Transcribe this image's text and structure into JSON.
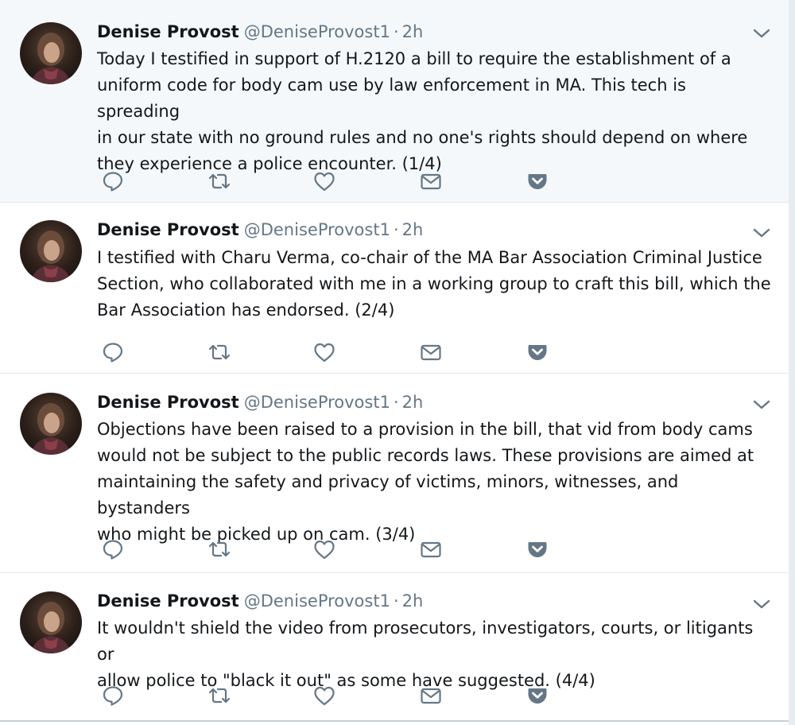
{
  "tweets": [
    {
      "author": "Denise Provost",
      "handle": "@DeniseProvost1",
      "separator": "·",
      "time": "2h",
      "text": "Today I testified in support of H.2120 a bill to require the establishment of a\nuniform code for body cam use by law enforcement in MA. This tech is spreading\nin our state with no ground rules and no one's rights should depend on where\nthey experience a police encounter. (1/4)"
    },
    {
      "author": "Denise Provost",
      "handle": "@DeniseProvost1",
      "separator": "·",
      "time": "2h",
      "text": "I testified with Charu Verma, co-chair of the MA Bar Association Criminal Justice\nSection, who collaborated with me in a working group to craft this bill, which the\nBar Association has endorsed. (2/4)"
    },
    {
      "author": "Denise Provost",
      "handle": "@DeniseProvost1",
      "separator": "·",
      "time": "2h",
      "text": "Objections have been raised to a provision in the bill, that vid from body cams\nwould not be subject to the public records laws. These provisions are aimed at\nmaintaining the safety and privacy of victims, minors, witnesses, and bystanders\nwho might be picked up on cam. (3/4)"
    },
    {
      "author": "Denise Provost",
      "handle": "@DeniseProvost1",
      "separator": "·",
      "time": "2h",
      "text": "It wouldn't shield the video from prosecutors, investigators, courts, or litigants or\nallow police to \"black it out\" as some have suggested. (4/4)"
    }
  ],
  "icons": {
    "reply": "reply-icon",
    "retweet": "retweet-icon",
    "like": "like-icon",
    "message": "direct-message-icon",
    "pocket": "pocket-icon",
    "caret": "chevron-down-icon"
  },
  "colors": {
    "icon": "#657786",
    "text": "#14171a",
    "muted": "#657786",
    "highlight_bg": "#f5f8fa",
    "border": "#e1e8ed"
  }
}
